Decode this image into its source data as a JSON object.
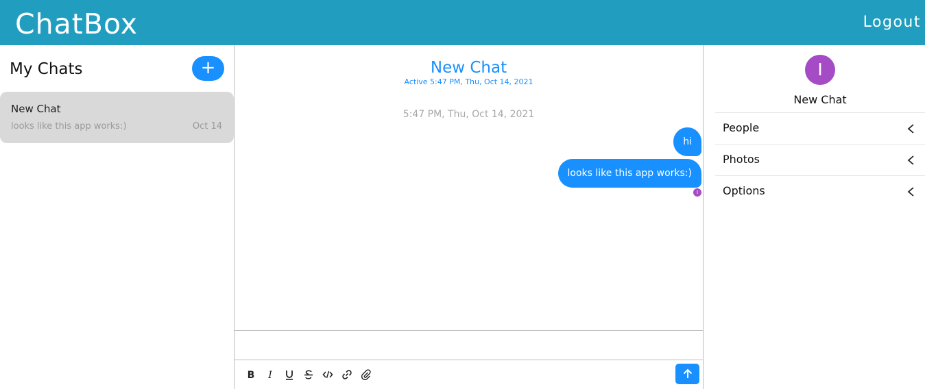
{
  "app": {
    "brand": "ChatBox",
    "logout": "Logout"
  },
  "chats": {
    "title": "My Chats",
    "add_label": "+",
    "items": [
      {
        "title": "New Chat",
        "preview": "looks like this app works:)",
        "date": "Oct 14"
      }
    ]
  },
  "chat": {
    "title": "New Chat",
    "active": "Active 5:47 PM, Thu, Oct 14, 2021",
    "timestamp": "5:47 PM, Thu, Oct 14, 2021",
    "messages": [
      {
        "text": "hi"
      },
      {
        "text": "looks like this app works:)"
      }
    ],
    "read_initial": "I",
    "composer": {
      "placeholder": ""
    },
    "toolbar": [
      "bold-icon",
      "italic-icon",
      "underline-icon",
      "strikethrough-icon",
      "code-icon",
      "link-icon",
      "attachment-icon"
    ]
  },
  "settings": {
    "avatar_initial": "I",
    "title": "New Chat",
    "sections": [
      {
        "label": "People"
      },
      {
        "label": "Photos"
      },
      {
        "label": "Options"
      }
    ]
  },
  "colors": {
    "header": "#219ebf",
    "accent": "#1890ff",
    "avatar": "#a54bc6",
    "chat_card": "#d9d9d9"
  }
}
